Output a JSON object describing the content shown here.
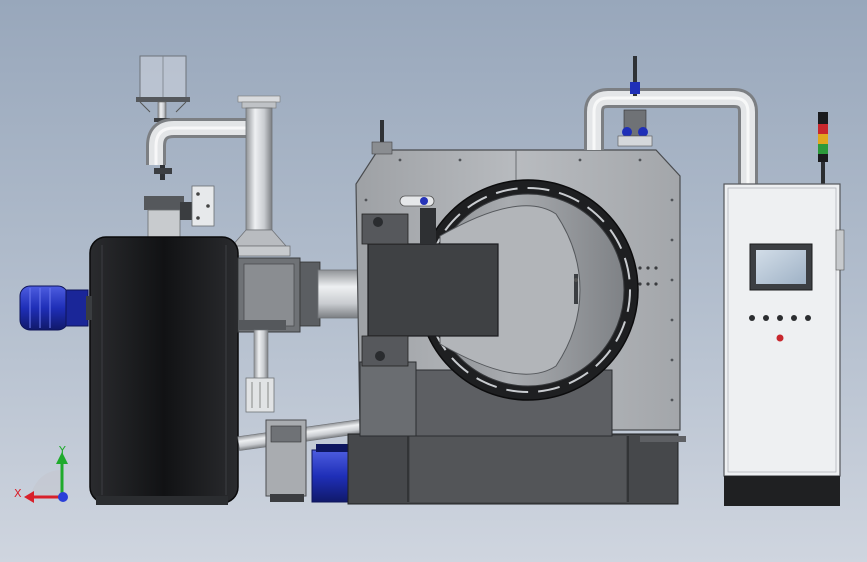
{
  "viewport": {
    "background_top": "#98a7bb",
    "background_bottom": "#cfd5df"
  },
  "triad": {
    "x_label": "X",
    "y_label": "Y",
    "x_color": "#d8202a",
    "y_color": "#1faa2c",
    "z_color": "#2a3fd8"
  },
  "colors": {
    "body_dark": "#1b1c1e",
    "chamber_grey": "#aeb1b5",
    "door_ring": "#1e1f21",
    "pipe_white": "#e4e6e8",
    "motor_blue": "#1f2fb8",
    "base_grey": "#46484b",
    "cabinet_white": "#eef0f2",
    "screen": "#b5c5d6"
  },
  "icons": {
    "motor": "blue-motor-icon",
    "signal_tower": "signal-tower-icon",
    "hmi_screen": "hmi-screen-icon"
  }
}
